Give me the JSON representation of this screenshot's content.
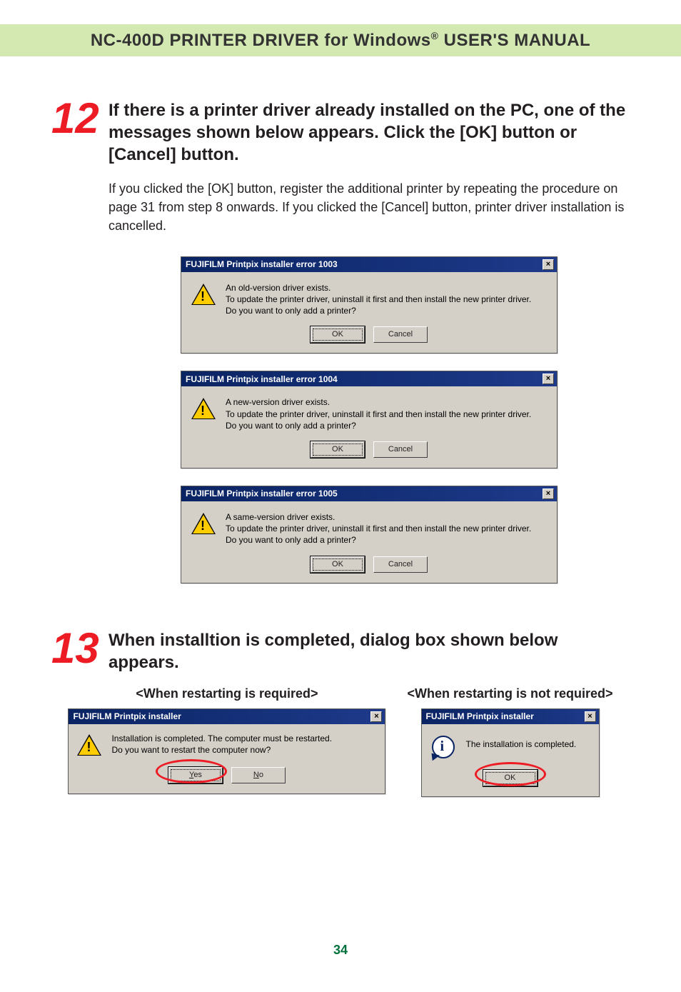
{
  "header": {
    "title_prefix": "NC-400D PRINTER DRIVER for Windows",
    "title_suffix": " USER'S MANUAL"
  },
  "step12": {
    "number": "12",
    "heading": "If there is a printer driver already installed on the PC, one of the messages shown below appears. Click the [OK] button or [Cancel] button.",
    "text": "If you clicked the [OK] button, register the additional printer by repeating the procedure on page 31 from step 8 onwards. If you clicked the [Cancel] button, printer driver installation is cancelled."
  },
  "dialogs": {
    "d1003": {
      "title": "FUJIFILM Printpix installer error 1003",
      "line1": "An old-version driver exists.",
      "line2": "To update the printer driver, uninstall it first and then install the new printer driver.",
      "line3": "Do you want to only add a printer?",
      "ok": "OK",
      "cancel": "Cancel"
    },
    "d1004": {
      "title": "FUJIFILM Printpix installer error 1004",
      "line1": "A new-version driver exists.",
      "line2": "To update the printer driver, uninstall it first and then install the new printer driver.",
      "line3": "Do you want to only add a printer?",
      "ok": "OK",
      "cancel": "Cancel"
    },
    "d1005": {
      "title": "FUJIFILM Printpix installer error 1005",
      "line1": "A same-version driver exists.",
      "line2": "To update the printer driver, uninstall it first and then install the new printer driver.",
      "line3": "Do you want to only add a printer?",
      "ok": "OK",
      "cancel": "Cancel"
    },
    "restart_req": {
      "subheader": "<When restarting is required>",
      "title": "FUJIFILM Printpix installer",
      "line1": "Installation is completed.  The computer must be restarted.",
      "line2": "Do you want to restart the computer now?",
      "yes": "Yes",
      "no": "No"
    },
    "restart_not": {
      "subheader": "<When restarting is not required>",
      "title": "FUJIFILM Printpix installer",
      "line1": "The installation is completed.",
      "ok": "OK"
    }
  },
  "step13": {
    "number": "13",
    "heading": "When installtion is completed, dialog box shown below appears."
  },
  "page_number": "34"
}
